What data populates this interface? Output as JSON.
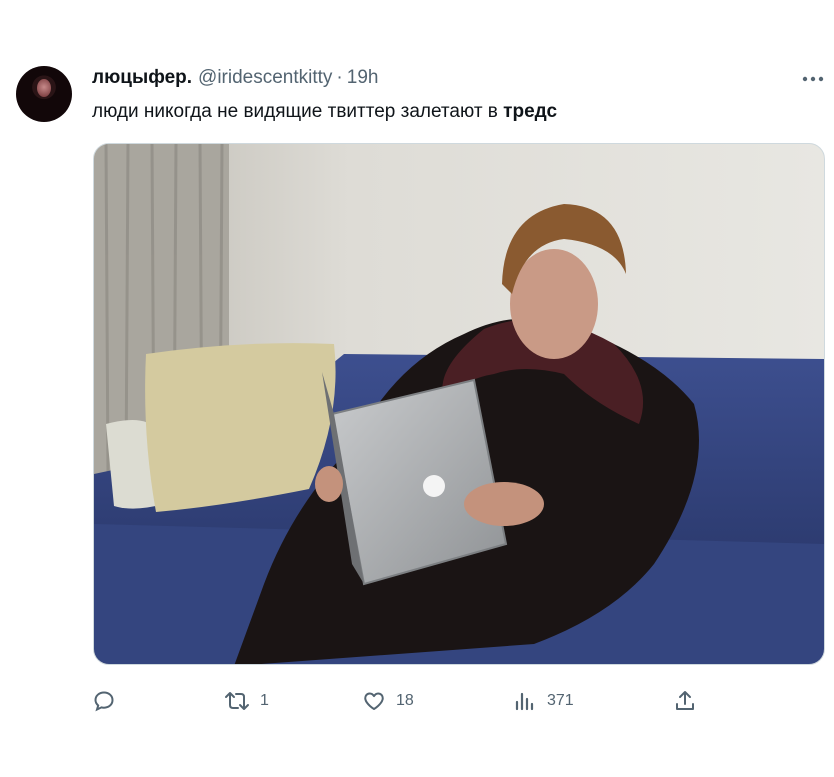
{
  "tweet": {
    "display_name": "люцыфер.",
    "handle": "@iridescentkitty",
    "separator": "·",
    "time": "19h",
    "text_plain": "люди никогда не видящие твиттер залетают в ",
    "text_bold": "тредс",
    "avatar_icon": "user-avatar",
    "more_icon": "more-dots-icon",
    "media_description": "",
    "actions": {
      "reply": {
        "icon": "reply-icon",
        "count": ""
      },
      "retweet": {
        "icon": "retweet-icon",
        "count": "1"
      },
      "like": {
        "icon": "heart-icon",
        "count": "18"
      },
      "views": {
        "icon": "views-chart-icon",
        "count": "371"
      },
      "share": {
        "icon": "share-icon",
        "count": ""
      }
    }
  },
  "colors": {
    "text_primary": "#0f1419",
    "text_secondary": "#536471",
    "border": "#cfd9de"
  }
}
